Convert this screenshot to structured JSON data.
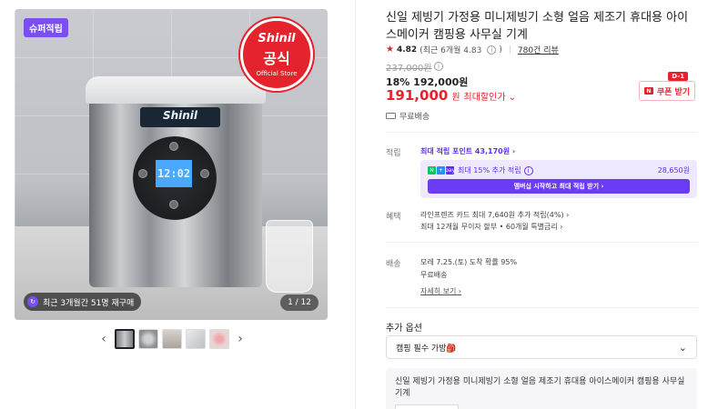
{
  "gallery": {
    "super_badge": "슈퍼적립",
    "seal": {
      "brand": "Shinil",
      "main": "공식",
      "sub": "Official Store"
    },
    "panel_display": "12:02",
    "repurchase_text": "최근 3개월간 51명 재구매",
    "pager": "1 / 12",
    "prev_arrow": "‹",
    "next_arrow": "›",
    "thumb_count": 5
  },
  "product": {
    "title": "신일 제빙기 가정용 미니제빙기 소형 얼음 제조기 휴대용 아이스메이커 캠핑용 사무실 기계",
    "rating": "4.82",
    "rating_detail": "(최근 6개월 4.83",
    "rating_info": "i",
    "rating_close": ")",
    "reviews": "780건 리뷰",
    "original_price": "237,000원",
    "discount_line": "18% 192,000원",
    "final_price": "191,000",
    "final_unit": "원",
    "final_label": "최대할인가 ⌄",
    "coupon_tag": "D-1",
    "coupon_label": "쿠폰 받기",
    "shipping_free": "무료배송"
  },
  "points": {
    "label": "적립",
    "max_points": "최대 적립 포인트 43,170원 ›",
    "member_text": "최대 15% 추가 적립",
    "member_amount": "28,650원",
    "member_button": "멤버십 시작하고 최대 적립 받기 ›"
  },
  "benefit": {
    "label": "혜택",
    "line1": "라인프렌즈 카드 최대 7,640원 추가 적립(4%) ›",
    "line2": "최대 12개월 무이자 할부 • 60개월 특별금리 ›"
  },
  "delivery": {
    "label": "배송",
    "line1": "모레 7.25.(토) 도착 확률 95%",
    "line2": "무료배송",
    "detail_link": "자세히 보기 ›"
  },
  "options": {
    "title": "추가 옵션",
    "select_value": "캠핑 필수 가방🎒",
    "chevron": "⌄",
    "selected_item": "신일 제빙기 가정용 미니제빙기 소형 얼음 제조기 휴대용 아이스메이커 캠핑용 사무실 기계"
  },
  "colors": {
    "accent_red": "#e5232c",
    "accent_purple": "#5d2ff0"
  }
}
